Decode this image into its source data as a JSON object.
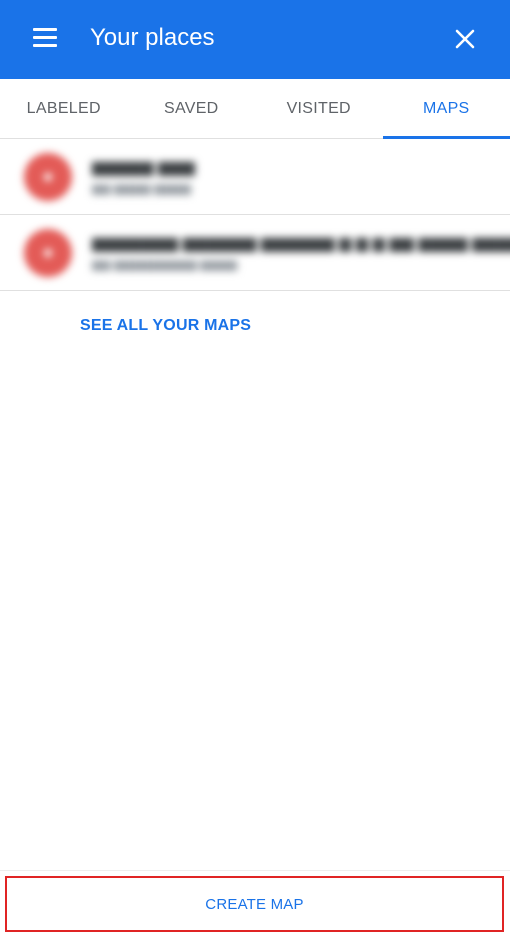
{
  "header": {
    "title": "Your places",
    "menu_icon": "menu-icon",
    "close_icon": "close-icon",
    "background_color": "#1a73e8"
  },
  "tabs": [
    {
      "label": "LABELED",
      "active": false
    },
    {
      "label": "SAVED",
      "active": false
    },
    {
      "label": "VISITED",
      "active": false
    },
    {
      "label": "MAPS",
      "active": true
    }
  ],
  "maps": [],
  "see_all_label": "SEE ALL YOUR MAPS",
  "create_map_label": "CREATE MAP",
  "accent_color": "#1a73e8",
  "highlight_color": "#e02424"
}
